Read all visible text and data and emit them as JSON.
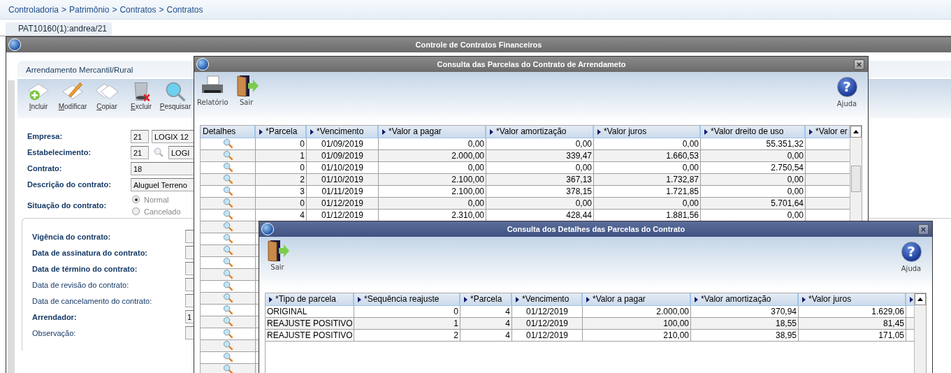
{
  "breadcrumb": {
    "separator": ">",
    "items": [
      "Controladoria",
      "Patrimônio",
      "Contratos",
      "Contratos"
    ]
  },
  "session_tab": {
    "label": "PAT10160(1):andrea/21",
    "selected": true
  },
  "main_window": {
    "title": "Controle de Contratos Financeiros",
    "panel_title": "Arrendamento Mercantil/Rural",
    "toolbar": [
      {
        "kind": "add",
        "label": "Incluir"
      },
      {
        "kind": "edit",
        "label": "Modificar"
      },
      {
        "kind": "copy",
        "label": "Copiar"
      },
      {
        "kind": "delete",
        "label": "Excluir"
      },
      {
        "kind": "search",
        "label": "Pesquisar"
      }
    ],
    "fields": [
      {
        "kind": "code_name",
        "label": "Empresa:",
        "required": true,
        "code": "21",
        "value": "LOGIX 12"
      },
      {
        "kind": "code_lookup",
        "label": "Estabelecimento:",
        "required": true,
        "code": "21",
        "value": "LOGI"
      },
      {
        "kind": "text",
        "label": "Contrato:",
        "required": true,
        "value": "18"
      },
      {
        "kind": "text",
        "label": "Descrição do contrato:",
        "required": true,
        "value": "Aluguel Terreno"
      },
      {
        "kind": "radio",
        "label": "Situação do contrato:",
        "required": true,
        "disabled": true,
        "options": [
          {
            "label": "Normal",
            "selected": true
          },
          {
            "label": "Cancelado",
            "selected": false
          }
        ]
      }
    ],
    "more_fields": [
      {
        "label": "Vigência do contrato:",
        "required": true
      },
      {
        "label": "Data de assinatura do contrato:",
        "required": true
      },
      {
        "label": "Data de término do contrato:",
        "required": true
      },
      {
        "label": "Data de revisão do contrato:",
        "required": false
      },
      {
        "label": "Data de cancelamento do contrato:",
        "required": false
      },
      {
        "label": "Arrendador:",
        "required": true,
        "value": "1"
      },
      {
        "label": "Observação:",
        "required": false
      }
    ]
  },
  "installments_dialog": {
    "title": "Consulta das Parcelas do Contrato de Arrendameto",
    "toolbar": [
      {
        "kind": "print",
        "label": "Relatório"
      },
      {
        "kind": "exit",
        "label": "Sair"
      }
    ],
    "help": {
      "symbol": "?",
      "label": "Ajuda"
    },
    "table": {
      "columns": [
        {
          "label": "Detalhes",
          "sortable": false
        },
        {
          "label": "*Parcela",
          "sortable": true
        },
        {
          "label": "*Vencimento",
          "sortable": true
        },
        {
          "label": "*Valor a pagar",
          "sortable": true
        },
        {
          "label": "*Valor amortização",
          "sortable": true
        },
        {
          "label": "*Valor juros",
          "sortable": true
        },
        {
          "label": "*Valor dreito de uso",
          "sortable": true
        },
        {
          "label": "*Valor er",
          "sortable": true
        }
      ],
      "rows": [
        {
          "kind": "full",
          "cells": [
            "0",
            "01/09/2019",
            "0,00",
            "0,00",
            "0,00",
            "55.351,32"
          ]
        },
        {
          "kind": "full",
          "cells": [
            "1",
            "01/09/2019",
            "2.000,00",
            "339,47",
            "1.660,53",
            "0,00"
          ]
        },
        {
          "kind": "full",
          "cells": [
            "0",
            "01/10/2019",
            "0,00",
            "0,00",
            "0,00",
            "2.750,54"
          ]
        },
        {
          "kind": "full",
          "cells": [
            "2",
            "01/10/2019",
            "2.100,00",
            "367,13",
            "1.732,87",
            "0,00"
          ]
        },
        {
          "kind": "full",
          "cells": [
            "3",
            "01/11/2019",
            "2.100,00",
            "378,15",
            "1.721,85",
            "0,00"
          ]
        },
        {
          "kind": "full",
          "cells": [
            "0",
            "01/12/2019",
            "0,00",
            "0,00",
            "0,00",
            "5.701,64"
          ]
        },
        {
          "kind": "full",
          "cells": [
            "4",
            "01/12/2019",
            "2.310,00",
            "428,44",
            "1.881,56",
            "0,00"
          ]
        },
        {
          "kind": "covered"
        },
        {
          "kind": "covered"
        },
        {
          "kind": "covered"
        },
        {
          "kind": "covered"
        },
        {
          "kind": "covered"
        },
        {
          "kind": "covered"
        },
        {
          "kind": "covered"
        },
        {
          "kind": "covered"
        },
        {
          "kind": "covered"
        },
        {
          "kind": "covered"
        },
        {
          "kind": "covered"
        },
        {
          "kind": "covered"
        },
        {
          "kind": "covered"
        }
      ]
    }
  },
  "details_dialog": {
    "title": "Consulta dos Detalhes das Parcelas do Contrato",
    "toolbar": [
      {
        "kind": "exit",
        "label": "Sair"
      }
    ],
    "help": {
      "symbol": "?",
      "label": "Ajuda"
    },
    "table": {
      "columns": [
        {
          "label": "*Tipo de parcela",
          "sortable": true
        },
        {
          "label": "*Sequência reajuste",
          "sortable": true
        },
        {
          "label": "*Parcela",
          "sortable": true
        },
        {
          "label": "*Vencimento",
          "sortable": true
        },
        {
          "label": "*Valor a pagar",
          "sortable": true
        },
        {
          "label": "*Valor amortização",
          "sortable": true
        },
        {
          "label": "*Valor juros",
          "sortable": true
        },
        {
          "sortable": true
        }
      ],
      "rows": [
        {
          "kind": "full",
          "cells": [
            "ORIGINAL",
            "0",
            "4",
            "01/12/2019",
            "2.000,00",
            "370,94",
            "1.629,06"
          ]
        },
        {
          "kind": "full",
          "cells": [
            "REAJUSTE POSITIVO",
            "1",
            "4",
            "01/12/2019",
            "100,00",
            "18,55",
            "81,45"
          ]
        },
        {
          "kind": "full",
          "cells": [
            "REAJUSTE POSITIVO",
            "2",
            "4",
            "01/12/2019",
            "210,00",
            "38,95",
            "171,05"
          ]
        }
      ]
    }
  }
}
